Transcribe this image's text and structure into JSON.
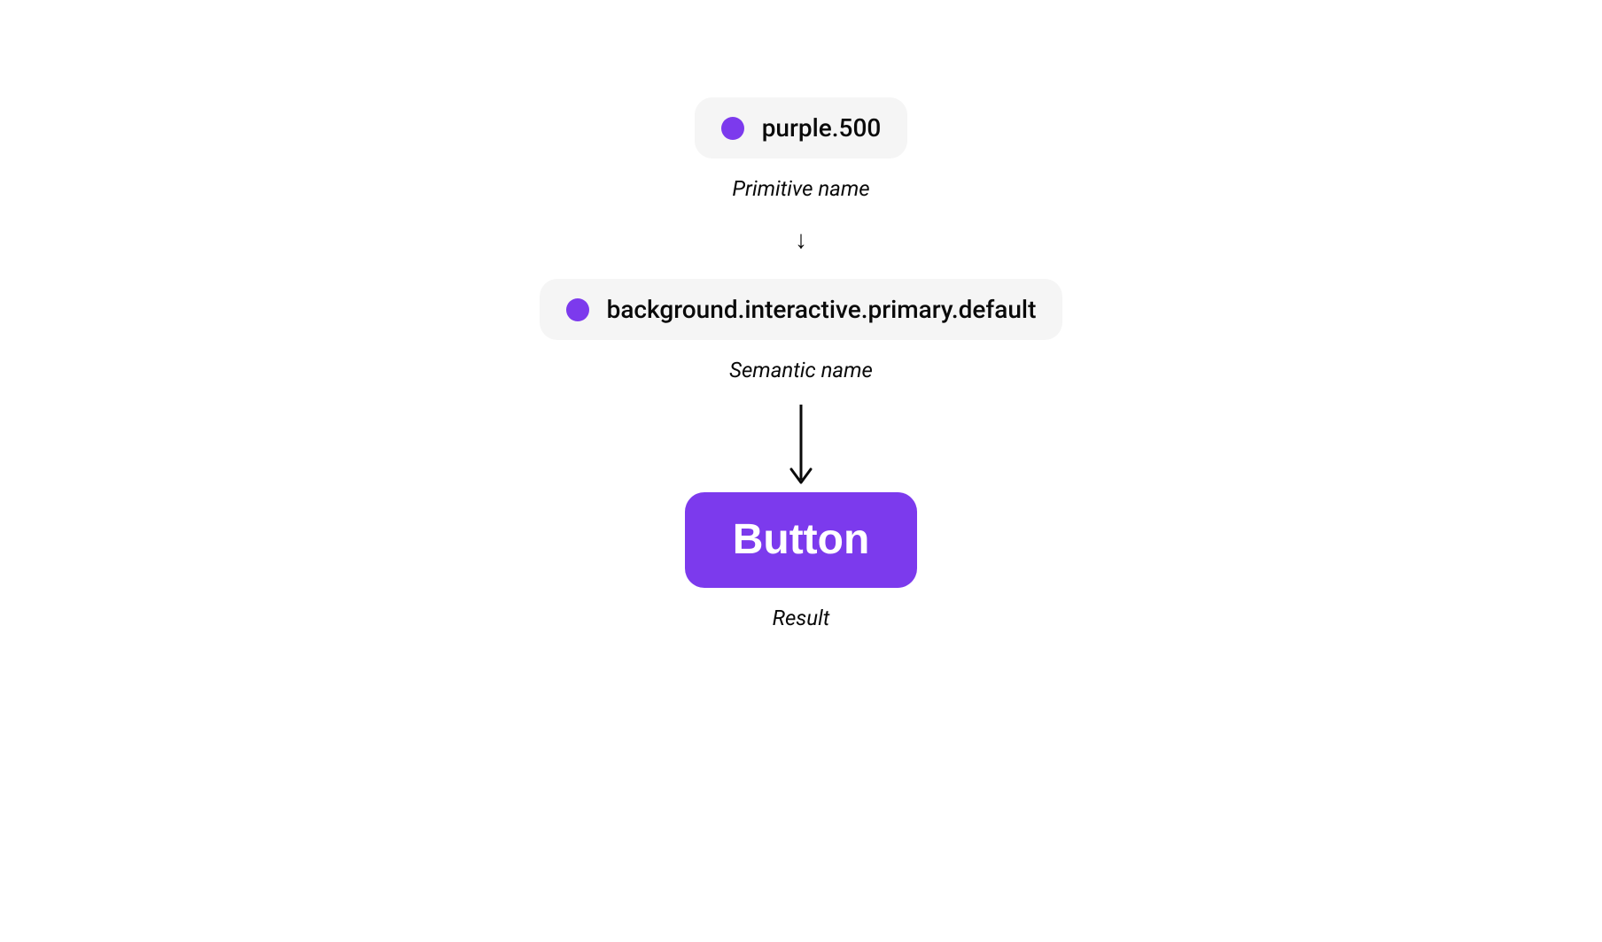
{
  "colors": {
    "purple500": "#7c3aed"
  },
  "primitive": {
    "token": "purple.500",
    "caption": "Primitive name"
  },
  "semantic": {
    "token": "background.interactive.primary.default",
    "caption": "Semantic name"
  },
  "result": {
    "label": "Button",
    "caption": "Result"
  },
  "arrows": {
    "small": "↓"
  }
}
